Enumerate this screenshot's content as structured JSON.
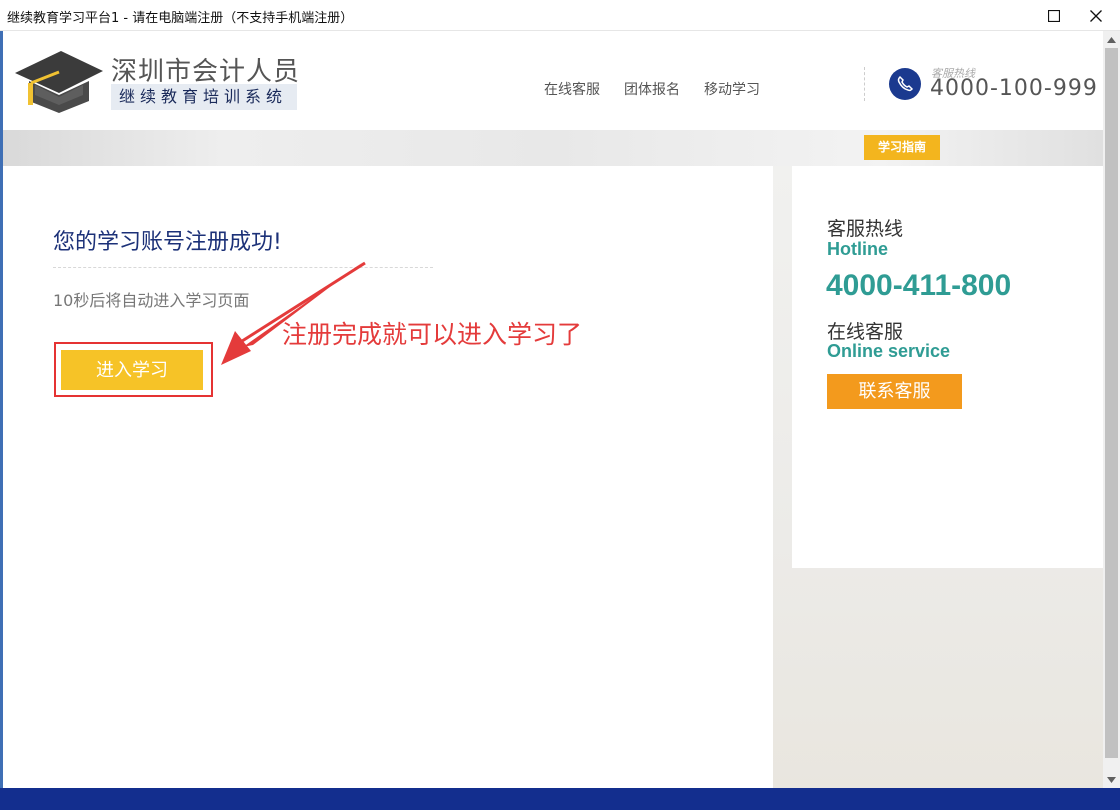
{
  "window": {
    "title": "继续教育学习平台1 - 请在电脑端注册（不支持手机端注册）"
  },
  "header": {
    "logo_title": "深圳市会计人员",
    "logo_subtitle": "继续教育培训系统",
    "nav": [
      {
        "label": "在线客服"
      },
      {
        "label": "团体报名"
      },
      {
        "label": "移动学习"
      }
    ],
    "hotline_label": "客服热线",
    "hotline_number": "4000-100-999"
  },
  "strip": {
    "guide_label": "学习指南"
  },
  "main": {
    "title": "您的学习账号注册成功!",
    "countdown": "10秒后将自动进入学习页面",
    "enter_button": "进入学习",
    "annotation": "注册完成就可以进入学习了"
  },
  "service": {
    "hotline_cn": "客服热线",
    "hotline_en": "Hotline",
    "hotline_number": "4000-411-800",
    "online_cn": "在线客服",
    "online_en": "Online service",
    "contact_button": "联系客服"
  },
  "colors": {
    "navy": "#1c3178",
    "teal": "#2f9c94",
    "yellow": "#f6c327",
    "orange": "#f39a1d",
    "annotation_red": "#e43b3b",
    "footer": "#132e8e"
  },
  "icons": [
    "maximize-icon",
    "close-icon",
    "graduation-cap-icon",
    "phone-icon",
    "annotation-arrow-icon",
    "scroll-up-icon",
    "scroll-down-icon"
  ]
}
